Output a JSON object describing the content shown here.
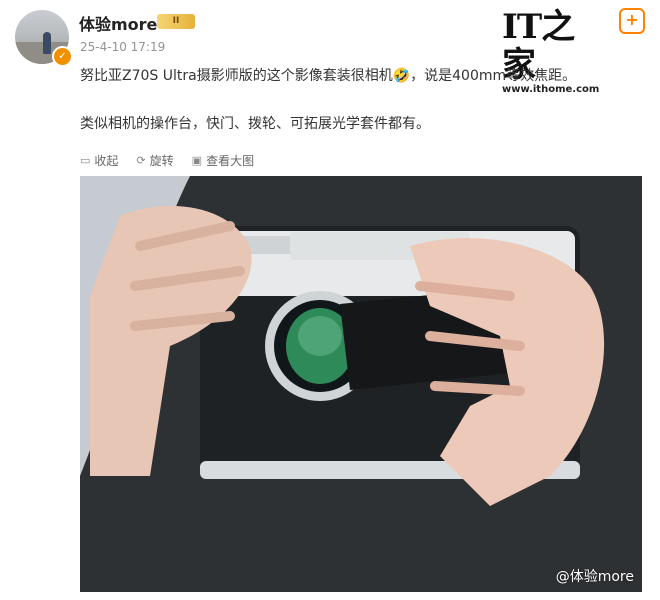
{
  "post": {
    "author": "体验more",
    "vip_badge": "II",
    "timestamp": "25-4-10 17:19",
    "text_line1": "努比亚Z70S Ultra摄影师版的这个影像套装很相机🤣，说是400mm等效焦距。",
    "text_line2": "类似相机的操作台，快门、拨轮、可拓展光学套件都有。"
  },
  "source_logo": {
    "mark": "IT之家",
    "url": "www.ithome.com"
  },
  "actions": [
    {
      "icon": "bookmark-icon",
      "label": "收起"
    },
    {
      "icon": "rotate-icon",
      "label": "旋转"
    },
    {
      "icon": "image-icon",
      "label": "查看大图"
    }
  ],
  "image": {
    "watermark": "@体验more"
  },
  "colors": {
    "accent": "#ff8200",
    "verified": "#f29100"
  }
}
